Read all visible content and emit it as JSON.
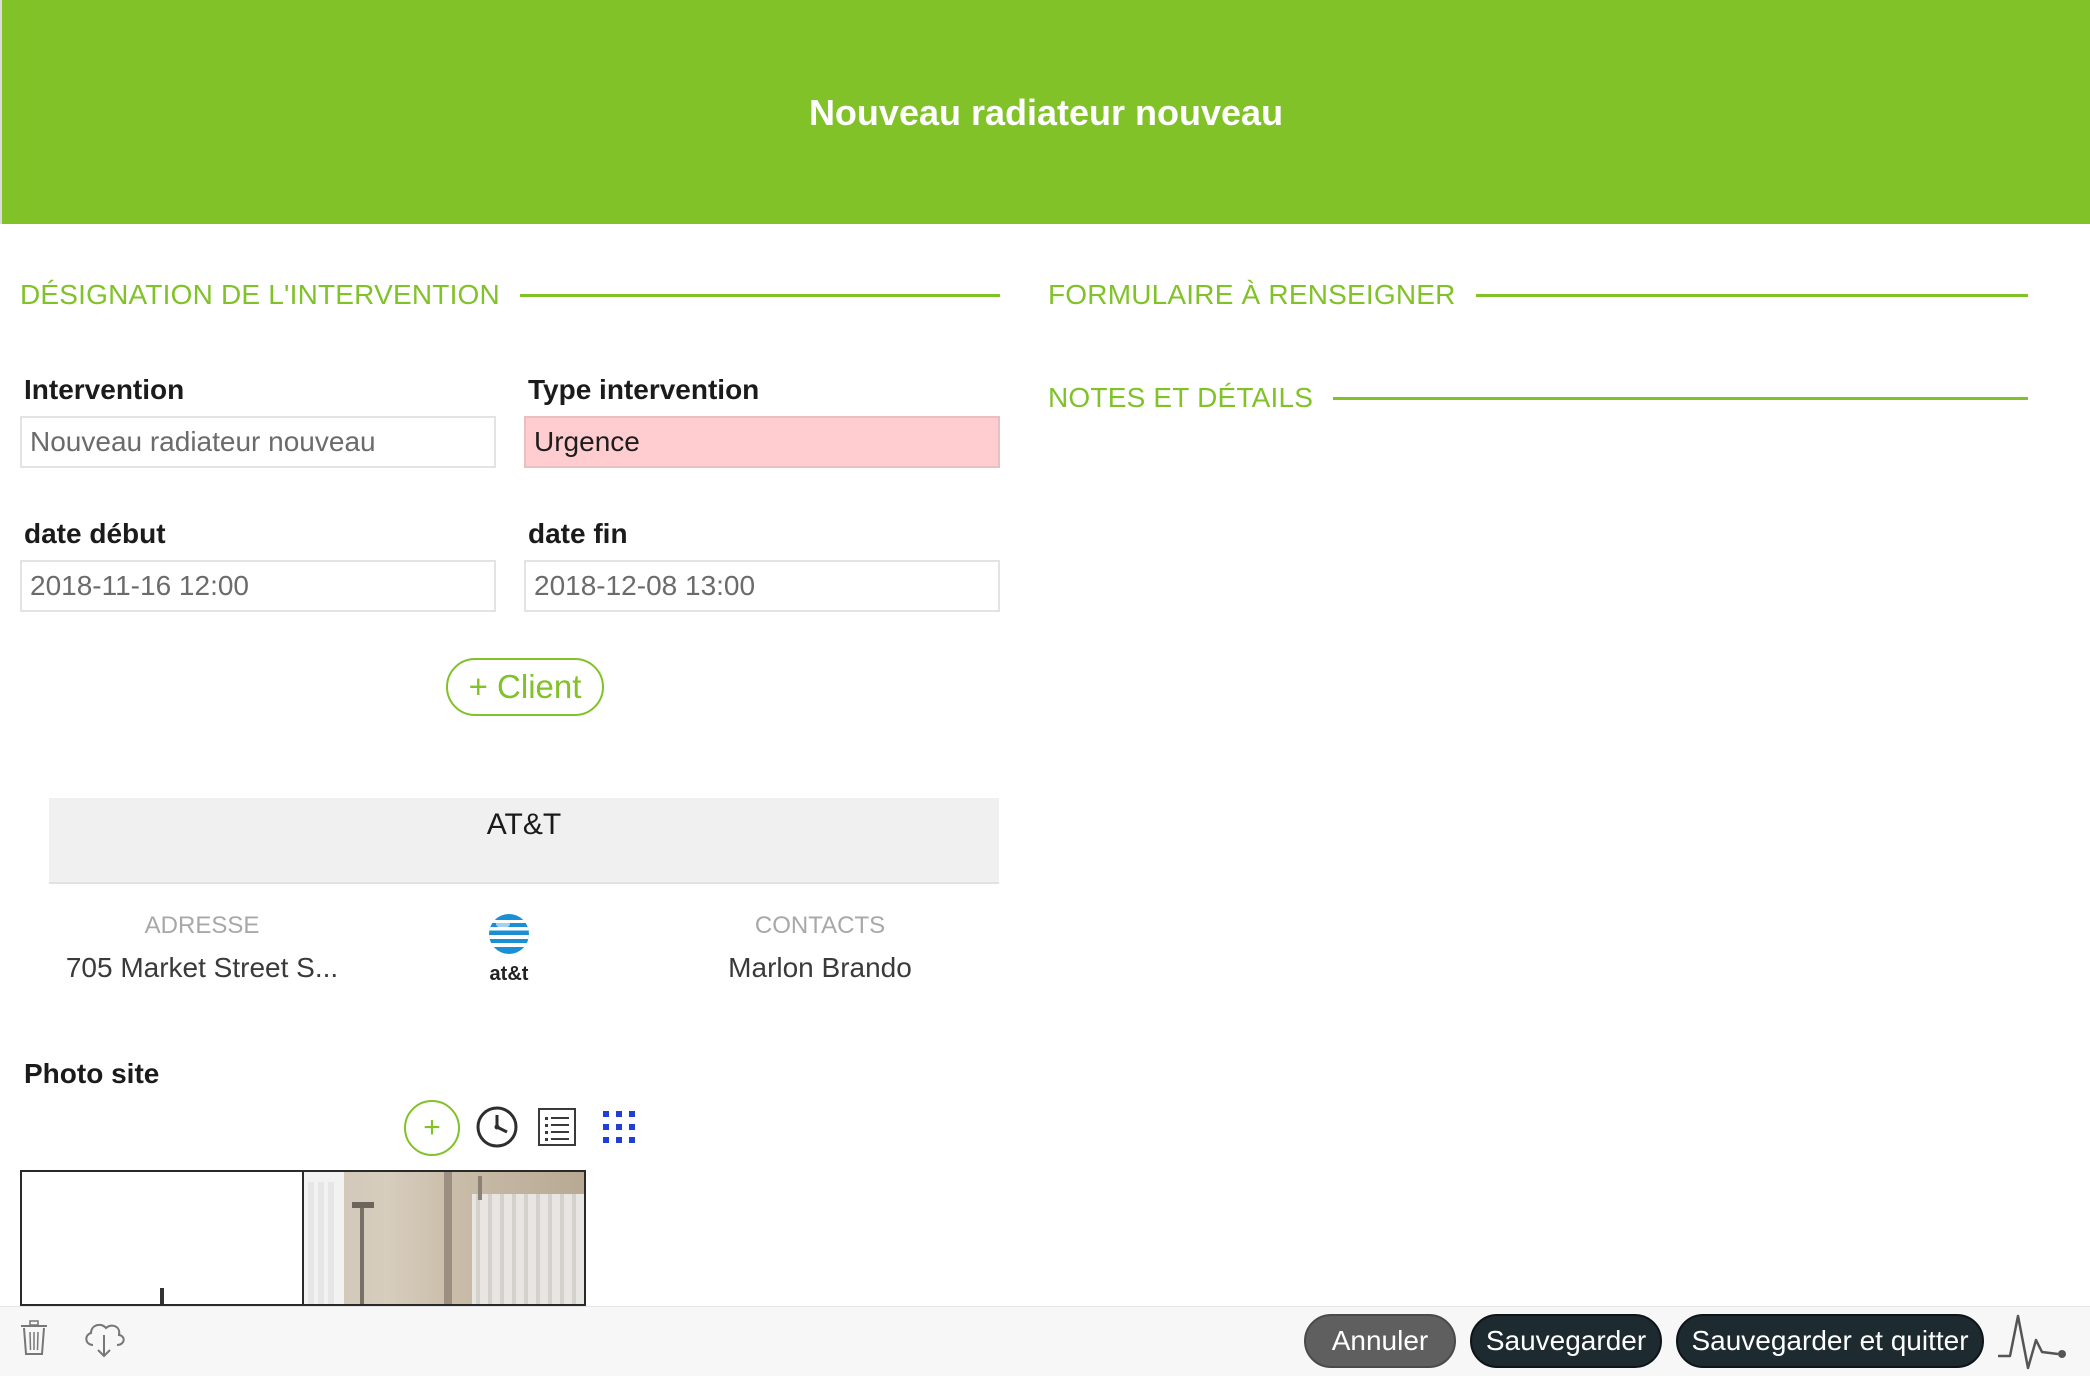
{
  "header": {
    "title": "Nouveau radiateur nouveau"
  },
  "sections": {
    "designation": "DÉSIGNATION DE L'INTERVENTION",
    "formulaire": "FORMULAIRE À RENSEIGNER",
    "notes": "NOTES ET DÉTAILS"
  },
  "form": {
    "intervention": {
      "label": "Intervention",
      "placeholder": "Nouveau radiateur nouveau"
    },
    "type": {
      "label": "Type intervention",
      "value": "Urgence"
    },
    "date_debut": {
      "label": "date début",
      "value": "2018-11-16 12:00"
    },
    "date_fin": {
      "label": "date fin",
      "value": "2018-12-08 13:00"
    }
  },
  "client_button": "+ Client",
  "client": {
    "name": "AT&T",
    "address_title": "ADRESSE",
    "address": "705 Market Street S...",
    "logo_text": "at&t",
    "contacts_title": "CONTACTS",
    "contact": "Marlon Brando"
  },
  "photos": {
    "label": "Photo site",
    "add_label": "+",
    "icons": [
      "plus-icon",
      "clock-icon",
      "list-icon",
      "grid-icon"
    ]
  },
  "footer": {
    "cancel": "Annuler",
    "save": "Sauvegarder",
    "save_quit": "Sauvegarder et quitter",
    "icons": [
      "trash-icon",
      "cloud-download-icon",
      "activity-icon"
    ]
  },
  "colors": {
    "accent": "#80c228",
    "urgent": "#ffcdd0",
    "dark_button": "#1d2a30",
    "grey_button": "#5f5f5f",
    "grid_icon": "#1f3fd6"
  }
}
